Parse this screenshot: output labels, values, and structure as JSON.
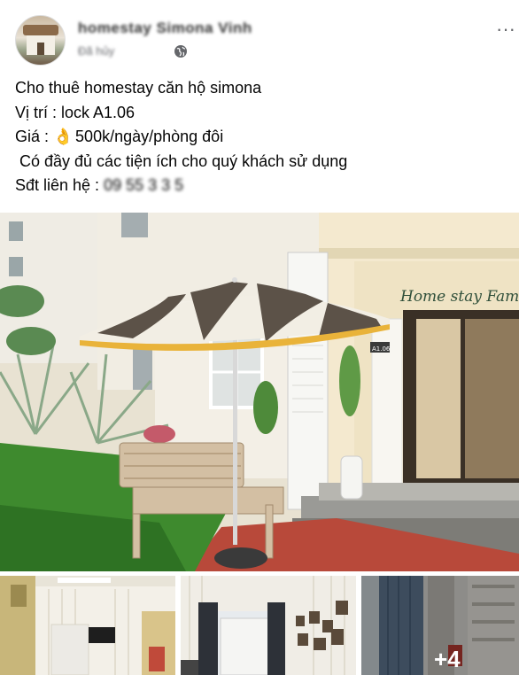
{
  "post": {
    "page_name": "homestay Simona Vinh",
    "time": "Đã hủy",
    "more_glyph": "···",
    "lines": [
      "Cho thuê homestay căn hộ simona",
      "Vị trí : lock A1.06",
      "Giá :",
      "500k/ngày/phòng đôi",
      " Có đầy đủ các tiện ích cho quý khách sử dụng",
      "Sđt liên hệ :",
      "09 55 3 3 5"
    ],
    "ok_emoji": "👌"
  },
  "photos": {
    "main_sign_text": "Home stay Family",
    "door_plate": "A1.06",
    "more_count": "+4"
  },
  "colors": {
    "text": "#050505",
    "meta": "#65676b",
    "umbrella_stripe_dark": "#5c5248",
    "umbrella_stripe_light": "#f2eee4",
    "umbrella_trim": "#e9b33a",
    "grass": "#3e8a2e",
    "tile": "#b8493a"
  }
}
